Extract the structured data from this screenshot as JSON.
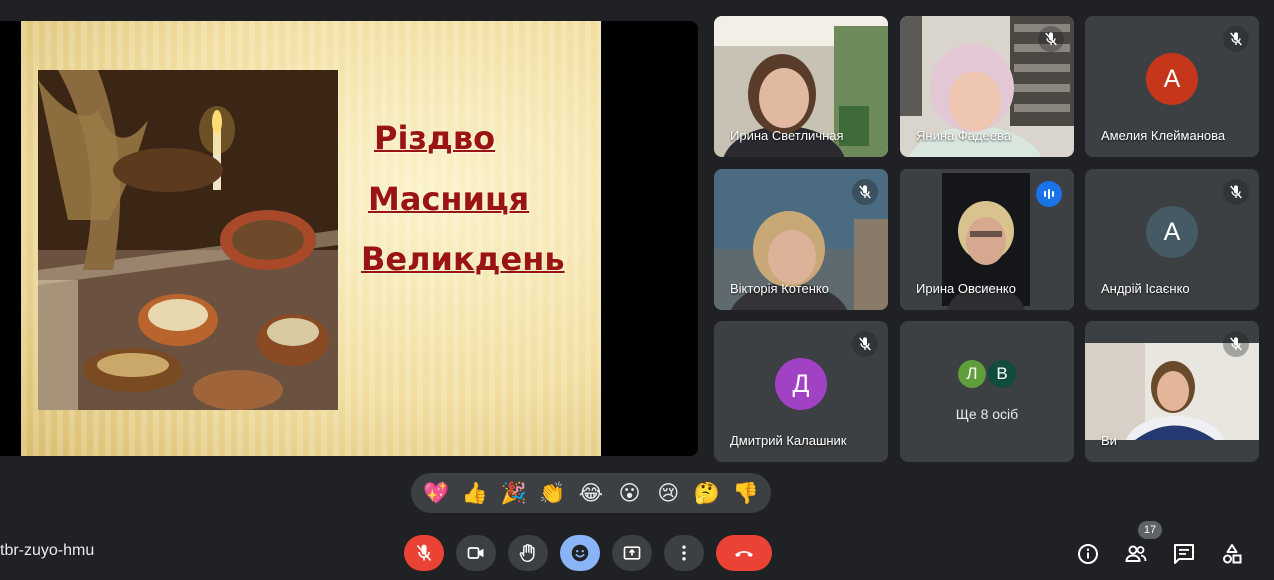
{
  "slide": {
    "words": [
      "Різдво",
      "Масниця",
      "Великдень"
    ]
  },
  "participants": [
    {
      "name": "Ирина Светличная"
    },
    {
      "name": "Янина Фадеева"
    },
    {
      "name": "Амелия Клейманова",
      "initial": "А",
      "color": "#c5361b"
    },
    {
      "name": "Вікторія Котенко"
    },
    {
      "name": "Ирина Овсиенко"
    },
    {
      "name": "Андрій Ісаєнко",
      "initial": "А",
      "color": "#455a64"
    },
    {
      "name": "Дмитрий Калашник",
      "initial": "Д",
      "color": "#a142c4"
    },
    {
      "name": "Ви"
    }
  ],
  "more": {
    "label": "Ще 8 осіб",
    "avatars": [
      {
        "initial": "Л",
        "color": "#5f9e3a"
      },
      {
        "initial": "В",
        "color": "#114b3c"
      }
    ]
  },
  "reactions": [
    "💖",
    "👍",
    "🎉",
    "👏",
    "😂",
    "😮",
    "😢",
    "🤔",
    "👎"
  ],
  "meeting": {
    "code": "tbr-zuyo-hmu",
    "participant_count": "17"
  },
  "controls": {
    "mic": "mic-off-icon",
    "camera": "camera-icon",
    "hand": "raise-hand-icon",
    "reactions": "emoji-icon",
    "present": "present-screen-icon",
    "more": "more-options-icon",
    "leave": "end-call-icon",
    "info": "info-icon",
    "people": "people-icon",
    "chat": "chat-icon",
    "activities": "activities-icon"
  },
  "colors": {
    "background": "#202124",
    "tile": "#3c4043",
    "leave": "#ea4335",
    "accent": "#8ab4f8",
    "slide_text": "#9a1414"
  }
}
